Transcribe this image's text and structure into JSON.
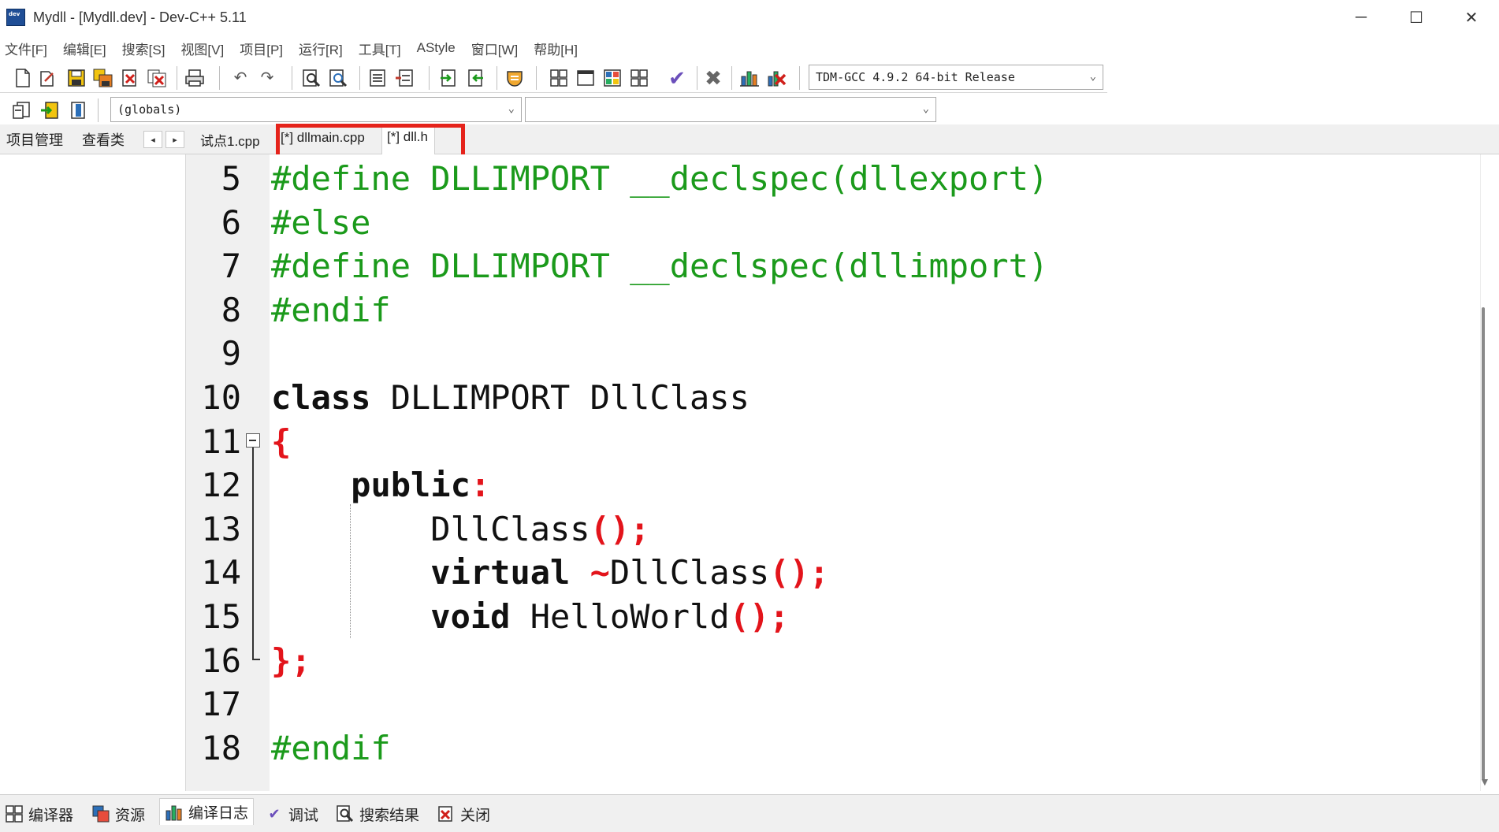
{
  "window": {
    "title": "Mydll - [Mydll.dev] - Dev-C++ 5.11",
    "minimize": "─",
    "maximize": "☐",
    "close": "✕"
  },
  "menu": [
    "文件[F]",
    "编辑[E]",
    "搜索[S]",
    "视图[V]",
    "项目[P]",
    "运行[R]",
    "工具[T]",
    "AStyle",
    "窗口[W]",
    "帮助[H]"
  ],
  "toolbar": {
    "compiler_select": "TDM-GCC 4.9.2 64-bit Release",
    "scope_select": "(globals)",
    "member_select": ""
  },
  "panel_tabs": [
    "项目管理",
    "查看类"
  ],
  "file_tabs": [
    "试点1.cpp",
    "[*] dllmain.cpp",
    "[*] dll.h"
  ],
  "editor": {
    "line_numbers": [
      "5",
      "6",
      "7",
      "8",
      "9",
      "10",
      "11",
      "12",
      "13",
      "14",
      "15",
      "16",
      "17",
      "18"
    ],
    "lines": [
      [
        {
          "t": "#define DLLIMPORT __declspec(dllexport)",
          "c": "pp"
        }
      ],
      [
        {
          "t": "#else",
          "c": "pp"
        }
      ],
      [
        {
          "t": "#define DLLIMPORT __declspec(dllimport)",
          "c": "pp"
        }
      ],
      [
        {
          "t": "#endif",
          "c": "pp"
        }
      ],
      [],
      [
        {
          "t": "class",
          "c": "kw"
        },
        {
          "t": " DLLIMPORT DllClass",
          "c": ""
        }
      ],
      [
        {
          "t": "{",
          "c": "pn"
        }
      ],
      [
        {
          "t": "    ",
          "c": ""
        },
        {
          "t": "public",
          "c": "kw"
        },
        {
          "t": ":",
          "c": "pn"
        }
      ],
      [
        {
          "t": "        DllClass",
          "c": ""
        },
        {
          "t": "();",
          "c": "pn"
        }
      ],
      [
        {
          "t": "        ",
          "c": ""
        },
        {
          "t": "virtual",
          "c": "kw"
        },
        {
          "t": " ",
          "c": ""
        },
        {
          "t": "~",
          "c": "pn"
        },
        {
          "t": "DllClass",
          "c": ""
        },
        {
          "t": "();",
          "c": "pn"
        }
      ],
      [
        {
          "t": "        ",
          "c": ""
        },
        {
          "t": "void",
          "c": "kw"
        },
        {
          "t": " HelloWorld",
          "c": ""
        },
        {
          "t": "();",
          "c": "pn"
        }
      ],
      [
        {
          "t": "};",
          "c": "pn"
        }
      ],
      [],
      [
        {
          "t": "#endif",
          "c": "pp"
        }
      ]
    ]
  },
  "bottom_tabs": [
    "编译器",
    "资源",
    "编译日志",
    "调试",
    "搜索结果",
    "关闭"
  ],
  "colors": {
    "preprocessor": "#1b9a1b",
    "punctuation": "#e3141b",
    "highlight_box": "#e5231b"
  }
}
